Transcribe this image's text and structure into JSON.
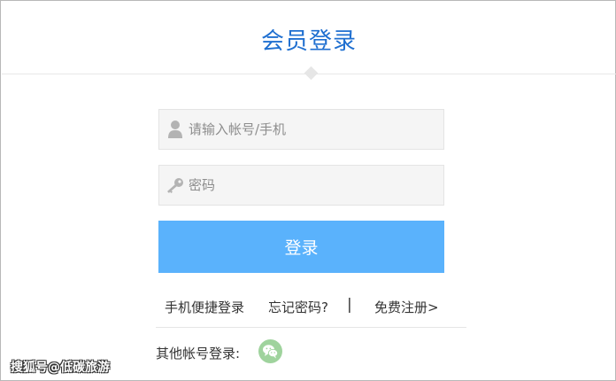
{
  "header": {
    "title": "会员登录"
  },
  "form": {
    "username_placeholder": "请输入帐号/手机",
    "username_value": "",
    "password_placeholder": "密码",
    "password_value": "",
    "login_label": "登录"
  },
  "links": {
    "phone_login": "手机便捷登录",
    "forgot_password": "忘记密码?",
    "separator": "|",
    "register": "免费注册>"
  },
  "social": {
    "label": "其他帐号登录:",
    "icon": "wechat-icon"
  },
  "watermark": {
    "text": "搜狐号@低碳旅游"
  },
  "colors": {
    "title": "#1f6fd0",
    "button": "#5ab2fc",
    "wechat": "#9fd39d",
    "field_bg": "#f5f5f5"
  }
}
